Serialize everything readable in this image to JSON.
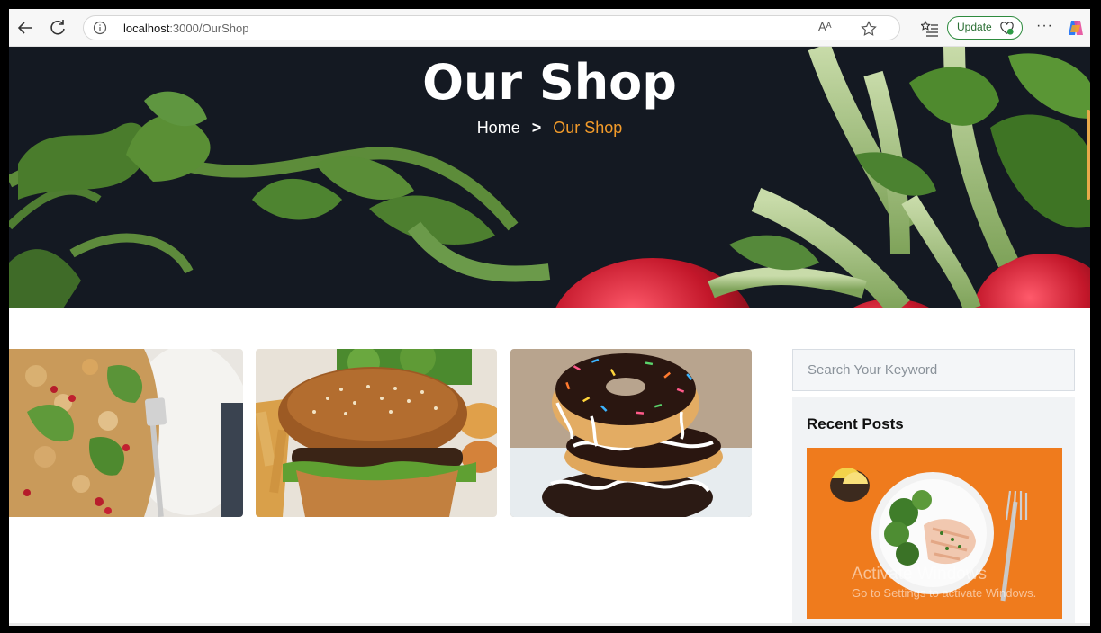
{
  "browser": {
    "url_host": "localhost",
    "url_path": ":3000/OurShop",
    "update_label": "Update",
    "read_aloud_label": "Aᴬ",
    "more_label": "···"
  },
  "hero": {
    "title": "Our Shop",
    "breadcrumb_home": "Home",
    "breadcrumb_separator": ">",
    "breadcrumb_current": "Our Shop",
    "accent_color": "#f39b2a"
  },
  "products": [
    {
      "name": "salad-image"
    },
    {
      "name": "burger-image"
    },
    {
      "name": "donuts-image"
    }
  ],
  "sidebar": {
    "search_placeholder": "Search Your Keyword",
    "recent_posts_title": "Recent Posts"
  },
  "watermark": {
    "line1": "Activate Windows",
    "line2": "Go to Settings to activate Windows."
  }
}
